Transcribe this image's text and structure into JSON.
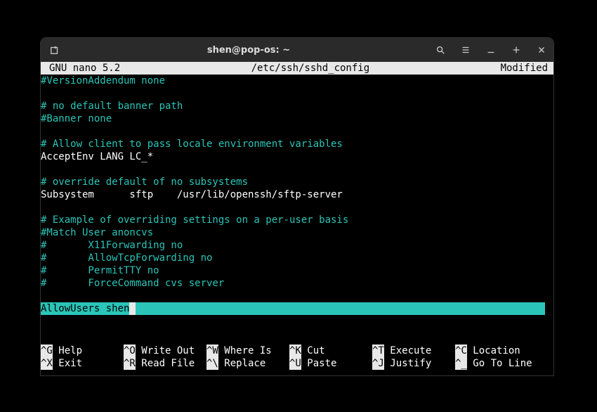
{
  "window": {
    "title": "shen@pop-os: ~"
  },
  "nano": {
    "app": "  GNU nano 5.2",
    "filename": "/etc/ssh/sshd_config",
    "status": "Modified"
  },
  "lines": [
    {
      "cls": "comment",
      "text": "#VersionAddendum none"
    },
    {
      "cls": "",
      "text": ""
    },
    {
      "cls": "comment",
      "text": "# no default banner path"
    },
    {
      "cls": "comment",
      "text": "#Banner none"
    },
    {
      "cls": "",
      "text": ""
    },
    {
      "cls": "comment",
      "text": "# Allow client to pass locale environment variables"
    },
    {
      "cls": "",
      "text": "AcceptEnv LANG LC_*"
    },
    {
      "cls": "",
      "text": ""
    },
    {
      "cls": "comment",
      "text": "# override default of no subsystems"
    },
    {
      "cls": "",
      "text": "Subsystem      sftp    /usr/lib/openssh/sftp-server"
    },
    {
      "cls": "",
      "text": ""
    },
    {
      "cls": "comment",
      "text": "# Example of overriding settings on a per-user basis"
    },
    {
      "cls": "comment",
      "text": "#Match User anoncvs"
    },
    {
      "cls": "comment",
      "text": "#       X11Forwarding no"
    },
    {
      "cls": "comment",
      "text": "#       AllowTcpForwarding no"
    },
    {
      "cls": "comment",
      "text": "#       PermitTTY no"
    },
    {
      "cls": "comment",
      "text": "#       ForceCommand cvs server"
    },
    {
      "cls": "",
      "text": ""
    }
  ],
  "cursor_line": "AllowUsers shen",
  "shortcuts": {
    "row1": [
      {
        "key": "^G",
        "label": " Help"
      },
      {
        "key": "^O",
        "label": " Write Out"
      },
      {
        "key": "^W",
        "label": " Where Is"
      },
      {
        "key": "^K",
        "label": " Cut"
      },
      {
        "key": "^T",
        "label": " Execute"
      },
      {
        "key": "^C",
        "label": " Location"
      }
    ],
    "row2": [
      {
        "key": "^X",
        "label": " Exit"
      },
      {
        "key": "^R",
        "label": " Read File"
      },
      {
        "key": "^\\",
        "label": " Replace"
      },
      {
        "key": "^U",
        "label": " Paste"
      },
      {
        "key": "^J",
        "label": " Justify"
      },
      {
        "key": "^_",
        "label": " Go To Line"
      }
    ]
  }
}
